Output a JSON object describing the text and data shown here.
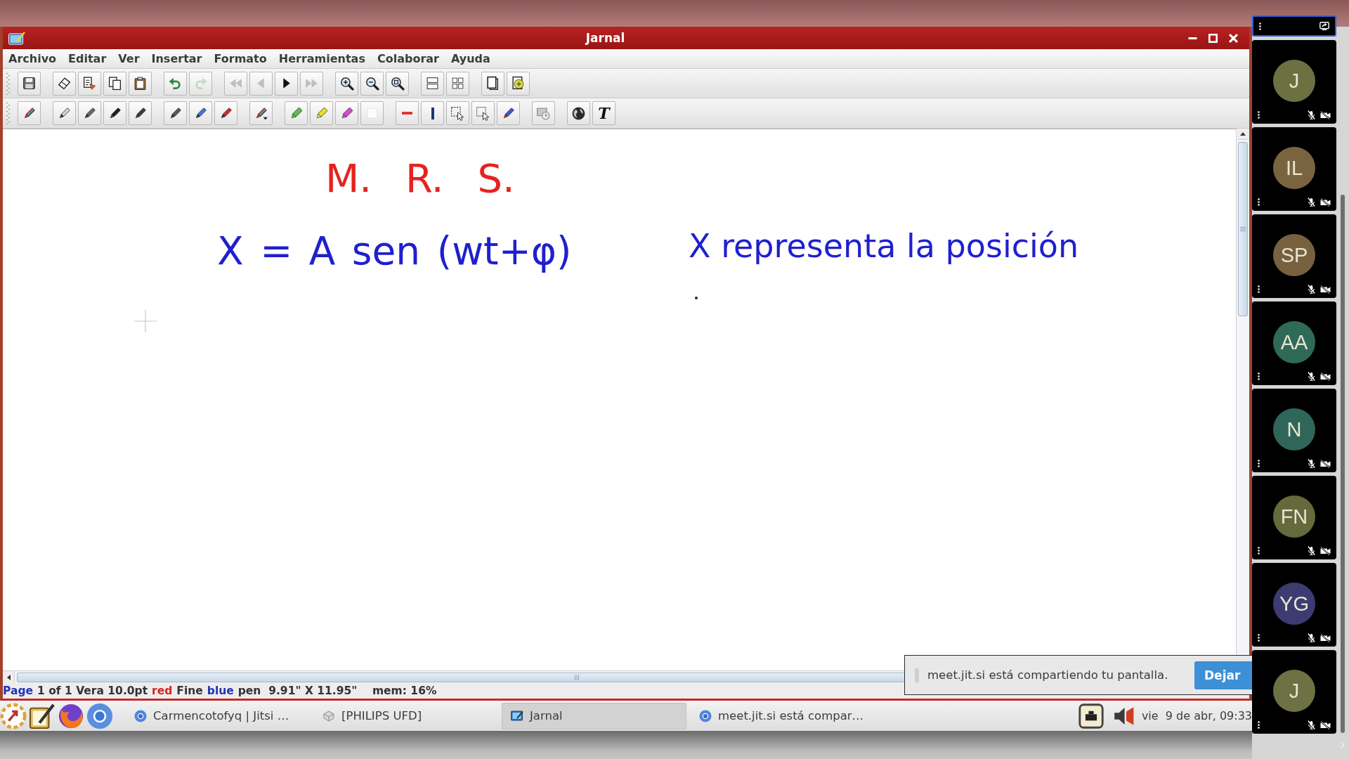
{
  "window": {
    "title": "Jarnal"
  },
  "menu": [
    "Archivo",
    "Editar",
    "Ver",
    "Insertar",
    "Formato",
    "Herramientas",
    "Colaborar",
    "Ayuda"
  ],
  "toolbar_1": [
    [
      {
        "kind": "save",
        "disabled": false
      }
    ],
    [
      {
        "kind": "clear",
        "disabled": false
      },
      {
        "kind": "copy-page",
        "disabled": false
      },
      {
        "kind": "copy",
        "disabled": false
      },
      {
        "kind": "paste",
        "disabled": false
      }
    ],
    [
      {
        "kind": "undo",
        "disabled": false
      },
      {
        "kind": "redo",
        "disabled": true
      }
    ],
    [
      {
        "kind": "first",
        "disabled": true
      },
      {
        "kind": "previous",
        "disabled": true
      },
      {
        "kind": "next",
        "disabled": false
      },
      {
        "kind": "last",
        "disabled": true
      }
    ],
    [
      {
        "kind": "zoom-in",
        "disabled": false
      },
      {
        "kind": "zoom-out",
        "disabled": false
      },
      {
        "kind": "zoom-fit",
        "disabled": false
      }
    ],
    [
      {
        "kind": "layout",
        "disabled": false
      },
      {
        "kind": "grid",
        "disabled": false
      }
    ],
    [
      {
        "kind": "page",
        "disabled": false
      },
      {
        "kind": "add-page",
        "disabled": false
      }
    ]
  ],
  "toolbar_2": [
    [
      {
        "kind": "pen-multi"
      }
    ],
    [
      {
        "kind": "pen",
        "color": "#d0d0d0"
      },
      {
        "kind": "pen",
        "color": "#6a6a6a"
      },
      {
        "kind": "pen",
        "color": "#1e1e1e"
      },
      {
        "kind": "pen",
        "color": "#3c3c3c"
      }
    ],
    [
      {
        "kind": "pen",
        "color": "#585858"
      },
      {
        "kind": "pen",
        "color": "#3f74e0"
      },
      {
        "kind": "pen",
        "color": "#d42a2a"
      }
    ],
    [
      {
        "kind": "pen-menu"
      }
    ],
    [
      {
        "kind": "highlighter",
        "color": "#5fbf4a"
      },
      {
        "kind": "highlighter",
        "color": "#e8e030"
      },
      {
        "kind": "highlighter",
        "color": "#d84ad8"
      },
      {
        "kind": "blank"
      }
    ],
    [
      {
        "kind": "line"
      },
      {
        "kind": "bar"
      },
      {
        "kind": "select"
      },
      {
        "kind": "select-add"
      },
      {
        "kind": "marker"
      }
    ],
    [
      {
        "kind": "image"
      }
    ],
    [
      {
        "kind": "globe"
      },
      {
        "kind": "text",
        "label": "T"
      }
    ]
  ],
  "canvas": {
    "ink": [
      {
        "text": "M. R. S.",
        "color": "#e42320"
      },
      {
        "text": "X = A sen (wt+φ)",
        "color": "#1f1fd0"
      },
      {
        "text": "X representa la posición",
        "color": "#1f1fd0"
      }
    ]
  },
  "status_bar": {
    "segments": [
      {
        "text": "Page",
        "color": "#2233b8"
      },
      {
        "text": "1 of 1 Vera 10.0pt",
        "color": "#333333"
      },
      {
        "text": "red",
        "color": "#dd2222"
      },
      {
        "text": "Fine",
        "color": "#333334"
      },
      {
        "text": "blue",
        "color": "#2233b9"
      },
      {
        "text": "pen  9.91\" X 11.95\"    mem: 16%",
        "color": "#333335"
      }
    ]
  },
  "share_notice": {
    "message": "meet.jit.si está compartiendo tu pantalla.",
    "button": "Dejar"
  },
  "taskbar": {
    "tasks": [
      {
        "kind": "browser",
        "label": "Carmencotofyq | Jitsi …",
        "selected": false
      },
      {
        "kind": "drive",
        "label": "[PHILIPS UFD]",
        "selected": false
      },
      {
        "kind": "editor",
        "label": "Jarnal",
        "selected": true
      },
      {
        "kind": "browser",
        "label": "meet.jit.si está compar…",
        "selected": false
      }
    ],
    "clock": "vie  9 de abr, 09:33"
  },
  "participants": [
    {
      "initials": "J",
      "color": "#6d7142",
      "muted": true,
      "camera_off": true
    },
    {
      "initials": "IL",
      "color": "#7a6440",
      "muted": true,
      "camera_off": true
    },
    {
      "initials": "SP",
      "color": "#77613f",
      "muted": true,
      "camera_off": true
    },
    {
      "initials": "AA",
      "color": "#2f6a58",
      "muted": true,
      "camera_off": true
    },
    {
      "initials": "N",
      "color": "#2f6659",
      "muted": true,
      "camera_off": true
    },
    {
      "initials": "FN",
      "color": "#646a3c",
      "muted": true,
      "camera_off": true
    },
    {
      "initials": "YG",
      "color": "#3c3c72",
      "muted": true,
      "camera_off": true
    },
    {
      "initials": "J",
      "color": "#6d7143",
      "muted": true,
      "camera_off": true
    }
  ]
}
